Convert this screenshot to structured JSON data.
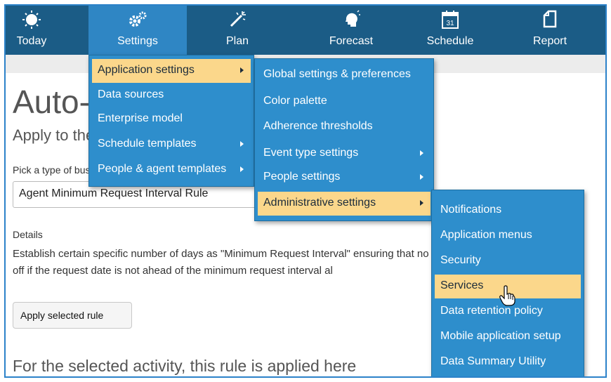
{
  "nav": [
    {
      "label": "Today",
      "icon": "sun-icon"
    },
    {
      "label": "Settings",
      "icon": "gears-icon"
    },
    {
      "label": "Plan",
      "icon": "wand-icon"
    },
    {
      "label": "Forecast",
      "icon": "lightbulb-head-icon"
    },
    {
      "label": "Schedule",
      "icon": "calendar-icon",
      "calendar_day": "31"
    },
    {
      "label": "Report",
      "icon": "document-icon"
    }
  ],
  "page": {
    "title": "Auto-approve rules",
    "subtitle": "Apply to the enterprise model",
    "pick_label": "Pick a type of business rule to apply",
    "select_value": "Agent Minimum Request Interval Rule",
    "details_label": "Details",
    "details_line1": "Establish certain specific number of days as \"Minimum Request Interval\" ensuring that no agent may",
    "details_line2": "off if the request date is not ahead of the minimum request interval al",
    "apply_button": "Apply selected rule",
    "footer_text": "For the selected activity, this rule is applied here"
  },
  "menu_settings": [
    {
      "label": "Application settings",
      "submenu": true,
      "highlighted": true
    },
    {
      "label": "Data sources",
      "submenu": false
    },
    {
      "label": "Enterprise model",
      "submenu": false
    },
    {
      "label": "Schedule templates",
      "submenu": true
    },
    {
      "label": "People & agent templates",
      "submenu": true
    }
  ],
  "menu_application": [
    {
      "label": "Global settings & preferences",
      "submenu": false
    },
    {
      "label": "Color palette",
      "submenu": false
    },
    {
      "label": "Adherence thresholds",
      "submenu": false
    },
    {
      "label": "Event type settings",
      "submenu": true
    },
    {
      "label": "People settings",
      "submenu": true
    },
    {
      "label": "Administrative settings",
      "submenu": true,
      "highlighted": true
    }
  ],
  "menu_admin": [
    {
      "label": "Notifications"
    },
    {
      "label": "Application menus"
    },
    {
      "label": "Security"
    },
    {
      "label": "Services",
      "highlighted": true
    },
    {
      "label": "Data retention policy"
    },
    {
      "label": "Mobile application setup"
    },
    {
      "label": "Data Summary Utility"
    }
  ],
  "colors": {
    "nav_bg": "#1b5c86",
    "nav_active": "#2f86c4",
    "menu_bg": "#2e8ecc",
    "highlight": "#fbd78b"
  }
}
